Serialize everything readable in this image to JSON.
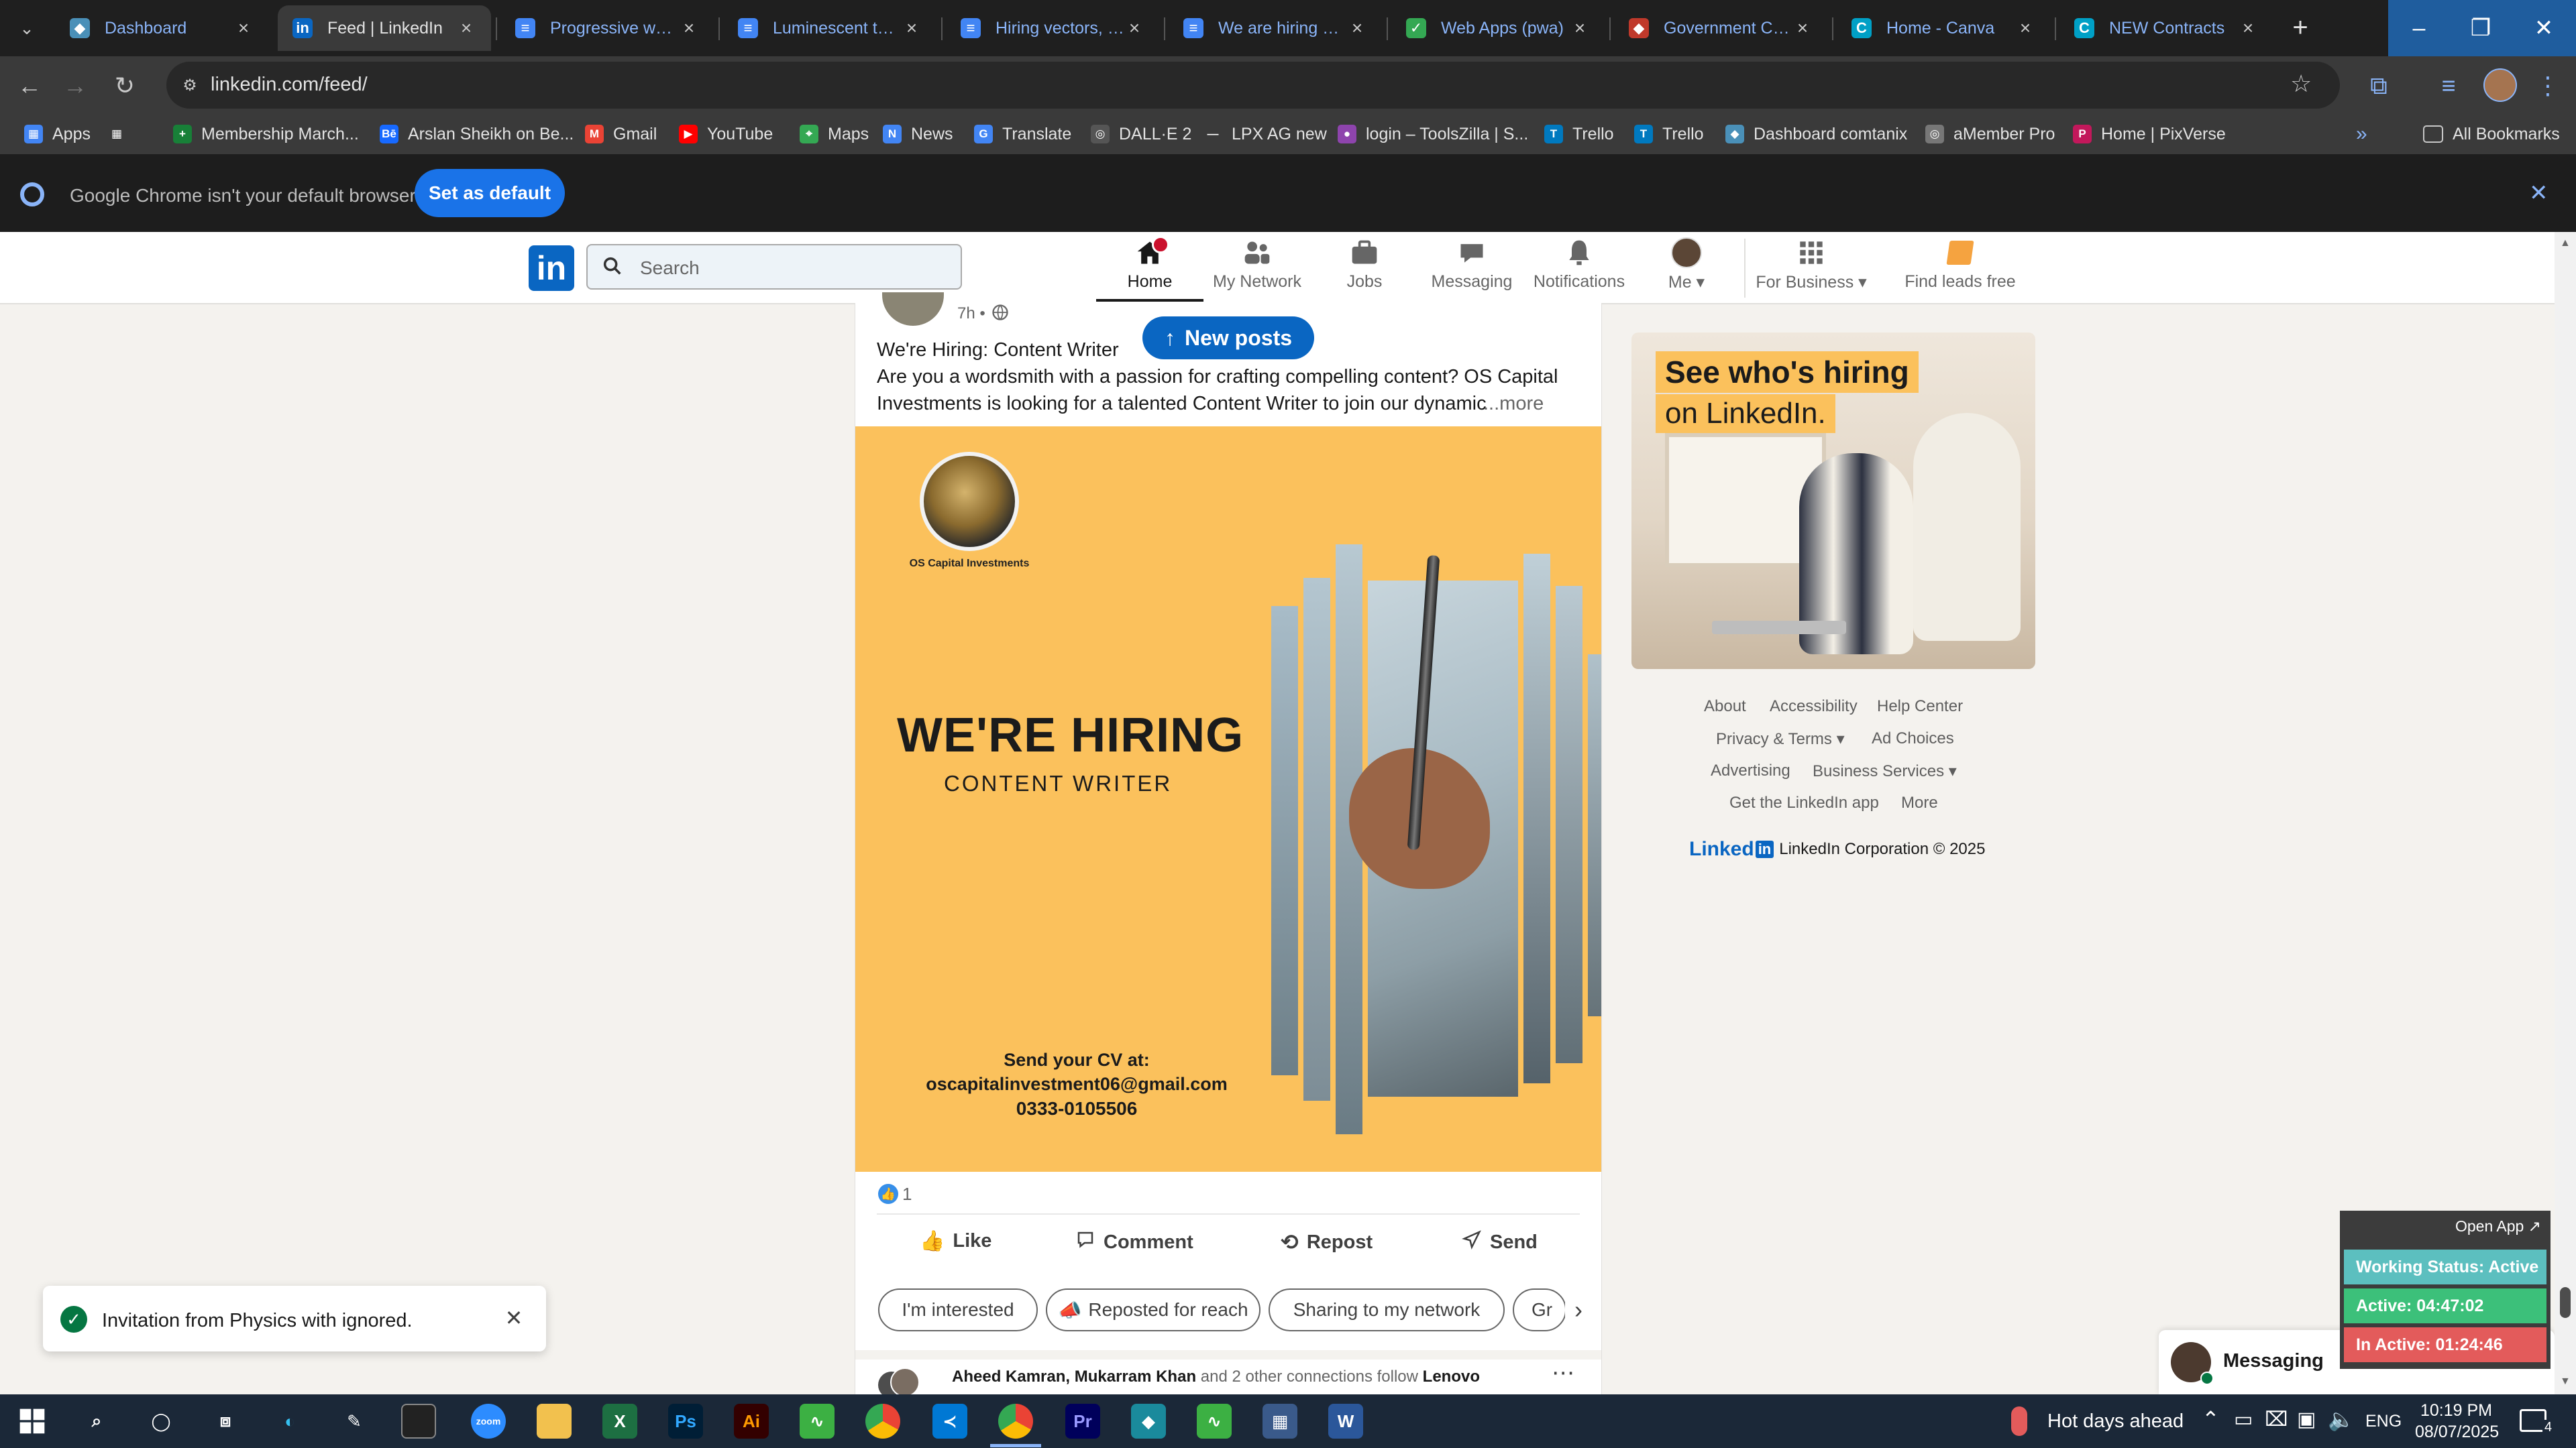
{
  "tabs": [
    {
      "title": "Dashboard",
      "fav_color": "#4a90b8",
      "fav_text": "◆"
    },
    {
      "title": "Feed | LinkedIn",
      "fav_color": "#0a66c2",
      "fav_text": "in"
    },
    {
      "title": "Progressive web app",
      "fav_color": "#4285f4",
      "fav_text": "≡"
    },
    {
      "title": "Luminescent tech",
      "fav_color": "#4285f4",
      "fav_text": "≡"
    },
    {
      "title": "Hiring vectors, photos",
      "fav_color": "#4285f4",
      "fav_text": "≡"
    },
    {
      "title": "We are hiring post",
      "fav_color": "#4285f4",
      "fav_text": "≡"
    },
    {
      "title": "Web Apps (pwa)",
      "fav_color": "#34a853",
      "fav_text": "✓"
    },
    {
      "title": "Government Contracts",
      "fav_color": "#c0392b",
      "fav_text": "◆"
    },
    {
      "title": "Home - Canva",
      "fav_color": "#00a0c6",
      "fav_text": "C"
    },
    {
      "title": "NEW Contracts",
      "fav_color": "#00a0c6",
      "fav_text": "C"
    }
  ],
  "address": {
    "url": "linkedin.com/feed/"
  },
  "bookmarks": [
    {
      "label": "Apps",
      "color": "#4285f4",
      "icon": "▦"
    },
    {
      "label": "",
      "color": "#3a3a3a",
      "icon": "▦"
    },
    {
      "label": "Membership March...",
      "color": "#188038",
      "icon": "+"
    },
    {
      "label": "Arslan Sheikh on Be...",
      "color": "#1769ff",
      "icon": "Bē"
    },
    {
      "label": "Gmail",
      "color": "#ea4335",
      "icon": "M"
    },
    {
      "label": "YouTube",
      "color": "#ff0000",
      "icon": "▶"
    },
    {
      "label": "Maps",
      "color": "#34a853",
      "icon": "⌖"
    },
    {
      "label": "News",
      "color": "#4285f4",
      "icon": "N"
    },
    {
      "label": "Translate",
      "color": "#4285f4",
      "icon": "G"
    },
    {
      "label": "DALL·E 2",
      "color": "#555555",
      "icon": "◎"
    },
    {
      "label": "LPX AG new",
      "color": "#3a3a3a",
      "icon": "—"
    },
    {
      "label": "login – ToolsZilla | S...",
      "color": "#8e44ad",
      "icon": "●"
    },
    {
      "label": "Trello",
      "color": "#0079bf",
      "icon": "T"
    },
    {
      "label": "Trello",
      "color": "#0079bf",
      "icon": "T"
    },
    {
      "label": "Dashboard comtanix",
      "color": "#4a90b8",
      "icon": "◆"
    },
    {
      "label": "aMember Pro",
      "color": "#777777",
      "icon": "◎"
    },
    {
      "label": "Home | PixVerse",
      "color": "#c2185b",
      "icon": "P"
    }
  ],
  "all_bookmarks": "All Bookmarks",
  "infobar": {
    "message": "Google Chrome isn't your default browser",
    "button": "Set as default"
  },
  "linkedin": {
    "search_placeholder": "Search",
    "nav": [
      {
        "label": "Home",
        "icon": "home-icon"
      },
      {
        "label": "My Network",
        "icon": "network-icon"
      },
      {
        "label": "Jobs",
        "icon": "briefcase-icon"
      },
      {
        "label": "Messaging",
        "icon": "chat-icon"
      },
      {
        "label": "Notifications",
        "icon": "bell-icon"
      },
      {
        "label": "Me ▾",
        "icon": "avatar"
      },
      {
        "label": "For Business ▾",
        "icon": "grid-icon"
      },
      {
        "label": "Find leads free",
        "icon": "tag-icon"
      }
    ]
  },
  "post": {
    "time": "7h •",
    "new_posts": "New posts",
    "headline": "We're Hiring: Content Writer",
    "body_line1": "Are you a wordsmith with a passion for crafting compelling content? OS Capital",
    "body_line2": "Investments is looking for a talented Content Writer to join our dynamic",
    "more": "...more",
    "image": {
      "company": "OS Capital Investments",
      "title": "WE'RE HIRING",
      "role": "CONTENT WRITER",
      "cv_label": "Send your CV at:",
      "email": "oscapitalinvestment06@gmail.com",
      "phone": "0333-0105506"
    },
    "reactions": "1",
    "actions": [
      "Like",
      "Comment",
      "Repost",
      "Send"
    ],
    "chips": [
      "I'm interested",
      "Reposted for reach",
      "Sharing to my network",
      "Gr"
    ],
    "next_post": {
      "names": "Aheed Kamran, Mukarram Khan",
      "rest": " and 2 other connections follow ",
      "company": "Lenovo"
    }
  },
  "ad": {
    "line1": "See who's hiring",
    "line2": "on LinkedIn."
  },
  "footer": {
    "row1": [
      "About",
      "Accessibility",
      "Help Center"
    ],
    "row2": [
      "Privacy & Terms ▾",
      "Ad Choices"
    ],
    "row3": [
      "Advertising",
      "Business Services ▾"
    ],
    "row4": [
      "Get the LinkedIn app",
      "More"
    ],
    "brand": "Linked",
    "copyright": "LinkedIn Corporation © 2025"
  },
  "toast": "Invitation from Physics with ignored.",
  "messaging": "Messaging",
  "tracker": {
    "open_app": "Open App ↗",
    "working": "Working Status: Active",
    "active": "Active: 04:47:02",
    "inactive": "In Active: 01:24:46"
  },
  "taskbar": {
    "weather": "Hot days ahead",
    "lang": "ENG",
    "time": "10:19 PM",
    "date": "08/07/2025",
    "notif": "4"
  },
  "colors": {
    "linkedin_blue": "#0a66c2",
    "notif_red": "#cb112d",
    "poster_yellow": "#fbc15c",
    "success": "#057642"
  }
}
